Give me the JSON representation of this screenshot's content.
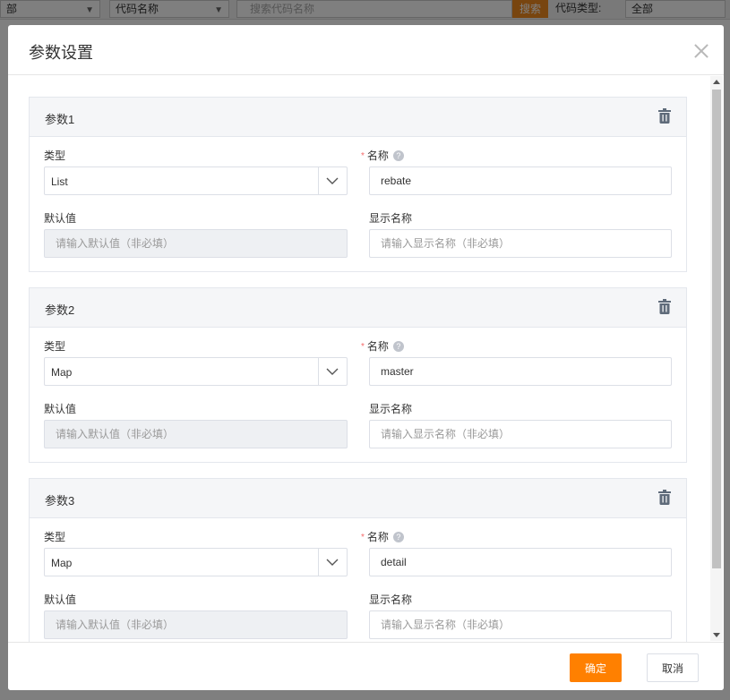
{
  "background": {
    "filter1_value": "部",
    "filter2_value": "代码名称",
    "search_placeholder": "搜索代码名称",
    "search_button": "搜索",
    "code_type_label": "代码类型:",
    "code_type_value": "全部"
  },
  "modal": {
    "title": "参数设置",
    "confirm_label": "确定",
    "cancel_label": "取消"
  },
  "labels": {
    "type": "类型",
    "name": "名称",
    "default_value": "默认值",
    "display_name": "显示名称",
    "help": "?"
  },
  "params": [
    {
      "title": "参数1",
      "type": "List",
      "name": "rebate",
      "default_placeholder": "请输入默认值（非必填）",
      "display_placeholder": "请输入显示名称（非必填）"
    },
    {
      "title": "参数2",
      "type": "Map",
      "name": "master",
      "default_placeholder": "请输入默认值（非必填）",
      "display_placeholder": "请输入显示名称（非必填）"
    },
    {
      "title": "参数3",
      "type": "Map",
      "name": "detail",
      "default_placeholder": "请输入默认值（非必填）",
      "display_placeholder": "请输入显示名称（非必填）"
    }
  ],
  "colors": {
    "primary": "#ff8000",
    "required": "#f56c6c"
  }
}
